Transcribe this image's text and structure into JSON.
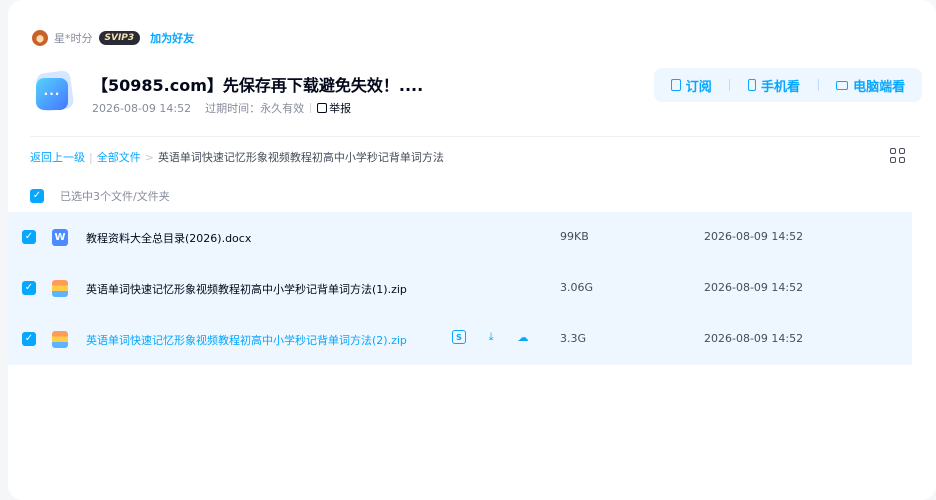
{
  "user": {
    "avatar_icon": "avatar-icon",
    "name": "星*时分",
    "vip_badge": "SVIP3",
    "add_friend": "加为好友"
  },
  "share": {
    "title": "【50985.com】先保存再下载避免失效！....",
    "date": "2026-08-09 14:52",
    "expire": "过期时间：永久有效",
    "report": "举报"
  },
  "actions": {
    "subscribe": "订阅",
    "phone_view": "手机看",
    "pc_view": "电脑端看"
  },
  "breadcrumb": {
    "back": "返回上一级",
    "all_files": "全部文件",
    "current": "英语单词快速记忆形象视频教程初高中小学秒记背单词方法"
  },
  "selection": {
    "label": "已选中3个文件/文件夹"
  },
  "files": [
    {
      "name": "教程资料大全总目录(2026).docx",
      "size": "99KB",
      "date": "2026-08-09 14:52",
      "type": "word"
    },
    {
      "name": "英语单词快速记忆形象视频教程初高中小学秒记背单词方法(1).zip",
      "size": "3.06G",
      "date": "2026-08-09 14:52",
      "type": "zip"
    },
    {
      "name": "英语单词快速记忆形象视频教程初高中小学秒记背单词方法(2).zip",
      "size": "3.3G",
      "date": "2026-08-09 14:52",
      "type": "zip"
    }
  ],
  "colors": {
    "accent": "#06a7ff",
    "row_selected_bg": "#eef7ff"
  }
}
